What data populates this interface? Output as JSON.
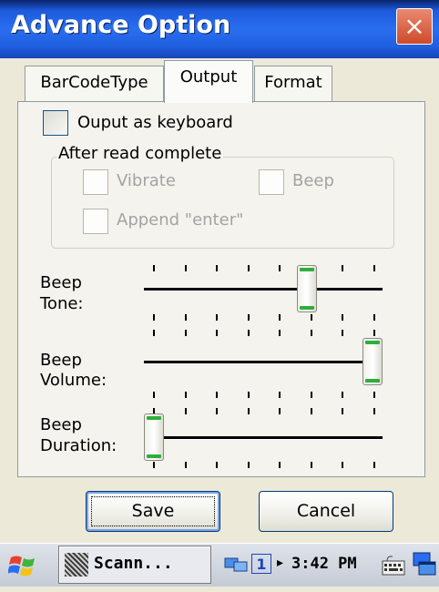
{
  "window": {
    "title": "Advance Option",
    "close_symbol": "×"
  },
  "tabs": [
    {
      "label": "BarCodeType",
      "active": false
    },
    {
      "label": "Output",
      "active": true
    },
    {
      "label": "Format",
      "active": false
    }
  ],
  "output": {
    "keyboard_label": "Ouput as keyboard",
    "group_label": "After read complete",
    "vibrate_label": "Vibrate",
    "beep_label": "Beep",
    "append_label": "Append \"enter\""
  },
  "sliders": {
    "tone": {
      "label1": "Beep",
      "label2": "Tone:",
      "level": 0.7
    },
    "volume": {
      "label1": "Beep",
      "label2": "Volume:",
      "level": 1.0
    },
    "duration": {
      "label1": "Beep",
      "label2": "Duration:",
      "level": 0.0
    }
  },
  "buttons": {
    "save": "Save",
    "cancel": "Cancel"
  },
  "taskbar": {
    "task_label": "Scann...",
    "input_indicator": "1",
    "arrow": "▸",
    "time": "3:42 PM",
    "start_icon": "windows-flag-icon"
  }
}
